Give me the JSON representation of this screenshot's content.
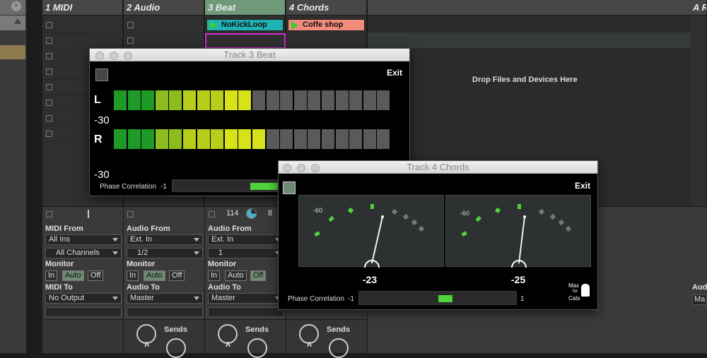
{
  "tracks": [
    {
      "title": "1 MIDI",
      "io_from_label": "MIDI From",
      "from_value": "All Ins",
      "channel_value": "All Channels",
      "monitor_label": "Monitor",
      "monitor_opts": [
        "In",
        "Auto",
        "Off"
      ],
      "to_label": "MIDI To",
      "to_value": "No Output"
    },
    {
      "title": "2 Audio",
      "io_from_label": "Audio From",
      "from_value": "Ext. In",
      "channel_value": "1/2",
      "monitor_label": "Monitor",
      "monitor_opts": [
        "In",
        "Auto",
        "Off"
      ],
      "to_label": "Audio To",
      "to_value": "Master",
      "sends_label": "Sends"
    },
    {
      "title": "3 Beat",
      "io_from_label": "Audio From",
      "from_value": "Ext. In",
      "channel_value": "1",
      "monitor_label": "Monitor",
      "monitor_opts": [
        "In",
        "Auto",
        "Off"
      ],
      "to_label": "Audio To",
      "to_value": "Master",
      "tempo": "114",
      "beats": "8",
      "sends_label": "Sends"
    },
    {
      "title": "4 Chords",
      "sends_label": "Sends"
    }
  ],
  "partial_track_title": "A R",
  "partial_audio_label": "Aud",
  "partial_master": "Ma",
  "clips": {
    "beat": {
      "name": "NoKickLoop",
      "color": "#20b2b2"
    },
    "chords": {
      "name": "Coffe shop",
      "color": "#f08c7c"
    }
  },
  "drop_area_text": "Drop Files and Devices Here",
  "knob_letter": "A",
  "window1": {
    "title": "Track 3 Beat",
    "exit_label": "Exit",
    "left_label": "L",
    "right_label": "R",
    "db_label_1": "-30",
    "db_label_2": "-30",
    "phase_label": "Phase Correlation",
    "phase_min": "-1",
    "left_level": 0.5,
    "right_level": 0.55
  },
  "window2": {
    "title": "Track 4 Chords",
    "exit_label": "Exit",
    "vu_scale_left": "-60",
    "vu_scale_right": "-60",
    "vu_left_value": "-23",
    "vu_right_value": "-25",
    "phase_label": "Phase Correlation",
    "phase_min": "-1",
    "phase_max": "1",
    "logo_line1": "Max",
    "logo_line2": "for",
    "logo_line3": "Cats"
  },
  "colors": {
    "meter_green": "#22a82a",
    "meter_yellow": "#d8e21a",
    "meter_off": "#5a5a5a",
    "vu_tick_green": "#4fd23a"
  }
}
